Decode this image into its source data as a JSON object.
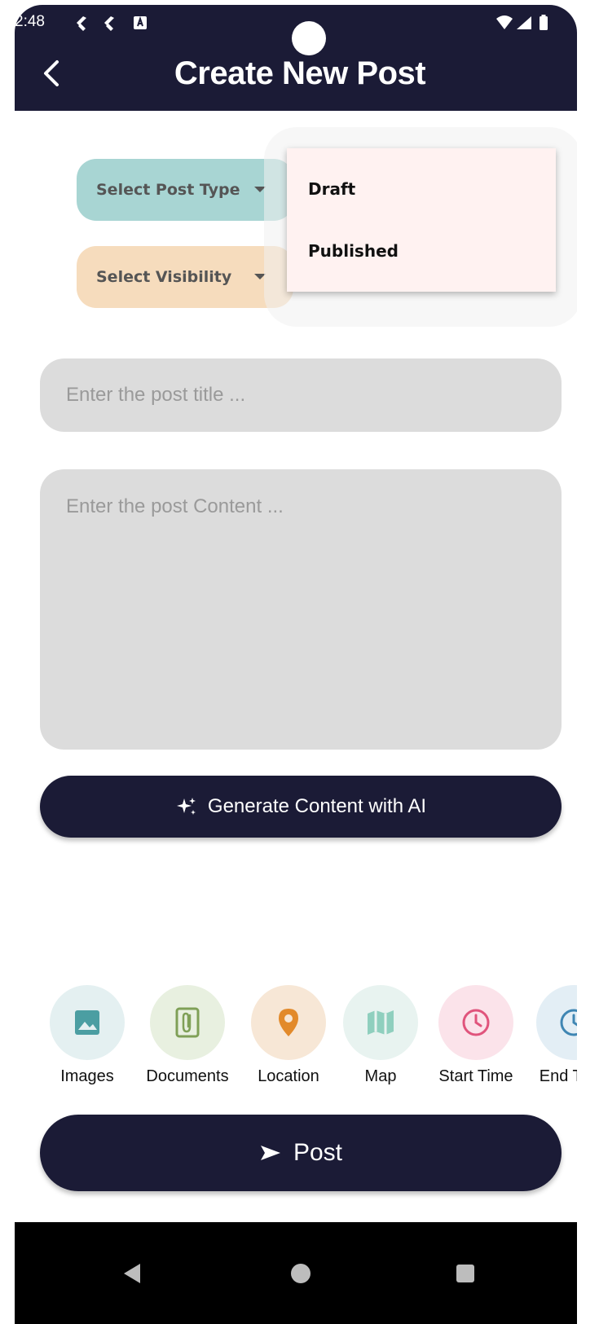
{
  "status_bar": {
    "time": "2:48"
  },
  "header": {
    "title": "Create New Post",
    "background": "#1b1b36"
  },
  "selectors": {
    "post_type": {
      "placeholder": "Select Post Type",
      "color": "#a8d5d3"
    },
    "visibility": {
      "placeholder": "Select Visibility",
      "color": "#f6dcbd"
    }
  },
  "dropdown_menu": {
    "items": [
      "Draft",
      "Published"
    ]
  },
  "form": {
    "title_placeholder": "Enter the post title ...",
    "content_placeholder": "Enter the post Content ..."
  },
  "ai_button": {
    "label": "Generate Content with AI",
    "icon": "sparkle-icon"
  },
  "attachments": [
    {
      "label": "Images",
      "icon": "image-icon",
      "bg": "#e4f0f1",
      "fg": "#4b9ea2"
    },
    {
      "label": "Documents",
      "icon": "document-icon",
      "bg": "#e8f0e0",
      "fg": "#7fa057"
    },
    {
      "label": "Location",
      "icon": "location-pin-icon",
      "bg": "#f7e7d6",
      "fg": "#e28a2b"
    },
    {
      "label": "Map",
      "icon": "map-icon",
      "bg": "#e8f3f0",
      "fg": "#8fcfbe"
    },
    {
      "label": "Start Time",
      "icon": "clock-icon",
      "bg": "#fbe3ea",
      "fg": "#e0547c"
    },
    {
      "label": "End Time",
      "icon": "clock-icon",
      "bg": "#e3eef5",
      "fg": "#3f86b3"
    }
  ],
  "post_button": {
    "label": "Post",
    "icon": "send-icon"
  }
}
